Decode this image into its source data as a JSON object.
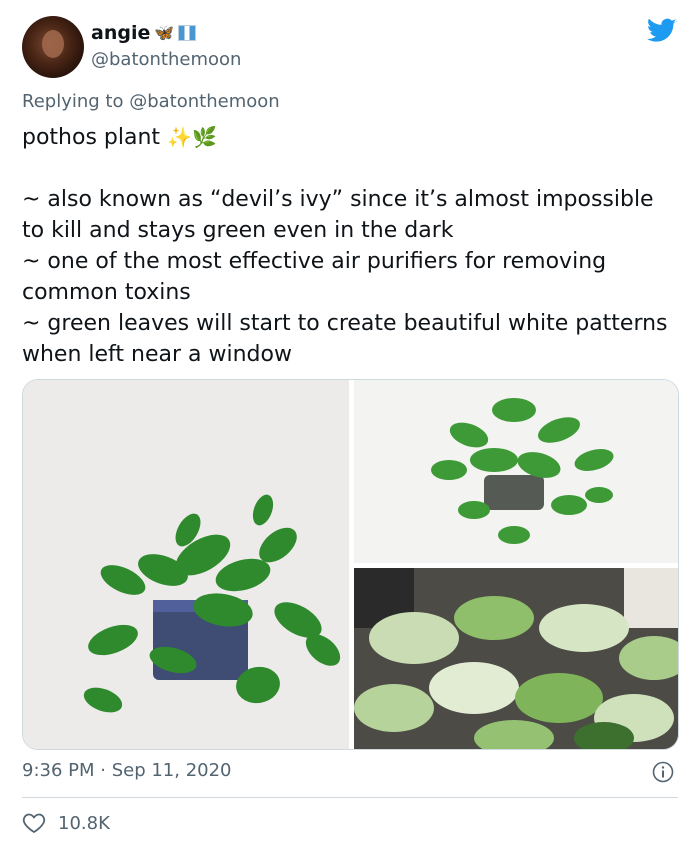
{
  "tweet": {
    "display_name": "angie",
    "name_emoji": "🦋",
    "handle": "@batonthemoon",
    "replying_label": "Replying to",
    "replying_handle": "@batonthemoon",
    "title_line": "pothos plant",
    "title_emoji": "✨🌿",
    "lines": [
      "~ also known as “devil’s ivy” since it’s almost impossible to kill and stays green even in the dark",
      "~ one of the most effective air purifiers for removing common toxins",
      "~ green leaves will start to create beautiful white patterns when left near a window"
    ],
    "timestamp": "9:36 PM · Sep 11, 2020",
    "like_count": "10.8K"
  },
  "icons": {
    "brand": "twitter-bird-icon",
    "info": "info-icon",
    "like": "heart-icon"
  },
  "colors": {
    "twitter_blue": "#1d9bf0",
    "secondary_text": "#536471",
    "primary_text": "#0f1419",
    "divider": "#cfd9de"
  }
}
